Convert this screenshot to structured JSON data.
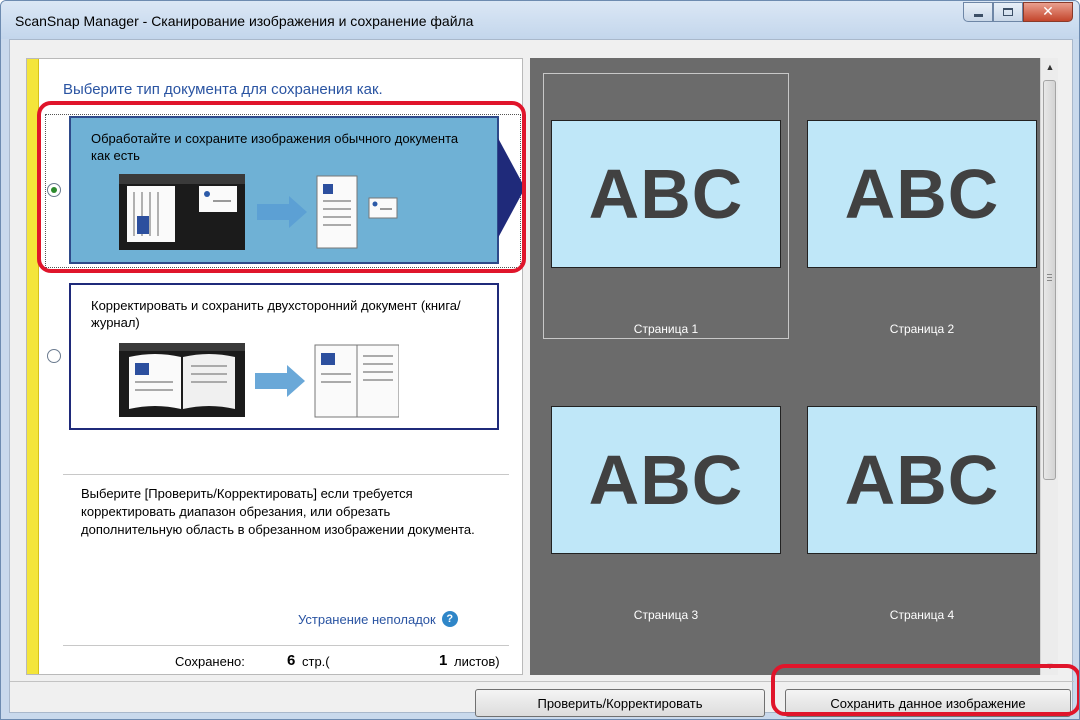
{
  "window": {
    "title": "ScanSnap Manager - Сканирование изображения и сохранение файла"
  },
  "left": {
    "heading": "Выберите тип документа для сохранения как.",
    "options": [
      {
        "label": "Обработайте и сохраните изображения обычного документа как есть",
        "selected": true
      },
      {
        "label": "Корректировать  и сохранить двухсторонний документ  (книга/журнал)",
        "selected": false
      }
    ],
    "help_text": "Выберите [Проверить/Корректировать] если требуется корректировать диапазон обрезания, или обрезать дополнительную область в обрезанном изображении документа.",
    "troubleshoot_link": "Устранение неполадок",
    "saved": {
      "label": "Сохранено:",
      "pages_count": "6",
      "pages_unit": "стр.(",
      "sheets_count": "1",
      "sheets_unit": "листов)"
    }
  },
  "pages": [
    {
      "text": "ABC",
      "caption": "Страница 1",
      "selected": true
    },
    {
      "text": "ABC",
      "caption": "Страница 2",
      "selected": false
    },
    {
      "text": "ABC",
      "caption": "Страница 3",
      "selected": false
    },
    {
      "text": "ABC",
      "caption": "Страница 4",
      "selected": false
    }
  ],
  "buttons": {
    "check": "Проверить/Корректировать",
    "save": "Сохранить данное изображение"
  },
  "colors": {
    "selected_option_bg": "#6fb1d5",
    "option_border": "#1f2a7a",
    "highlight_ring": "#e0152b",
    "preview_bg": "#6b6b6b",
    "page_bg": "#bfe7f8",
    "link": "#2a54a2"
  }
}
